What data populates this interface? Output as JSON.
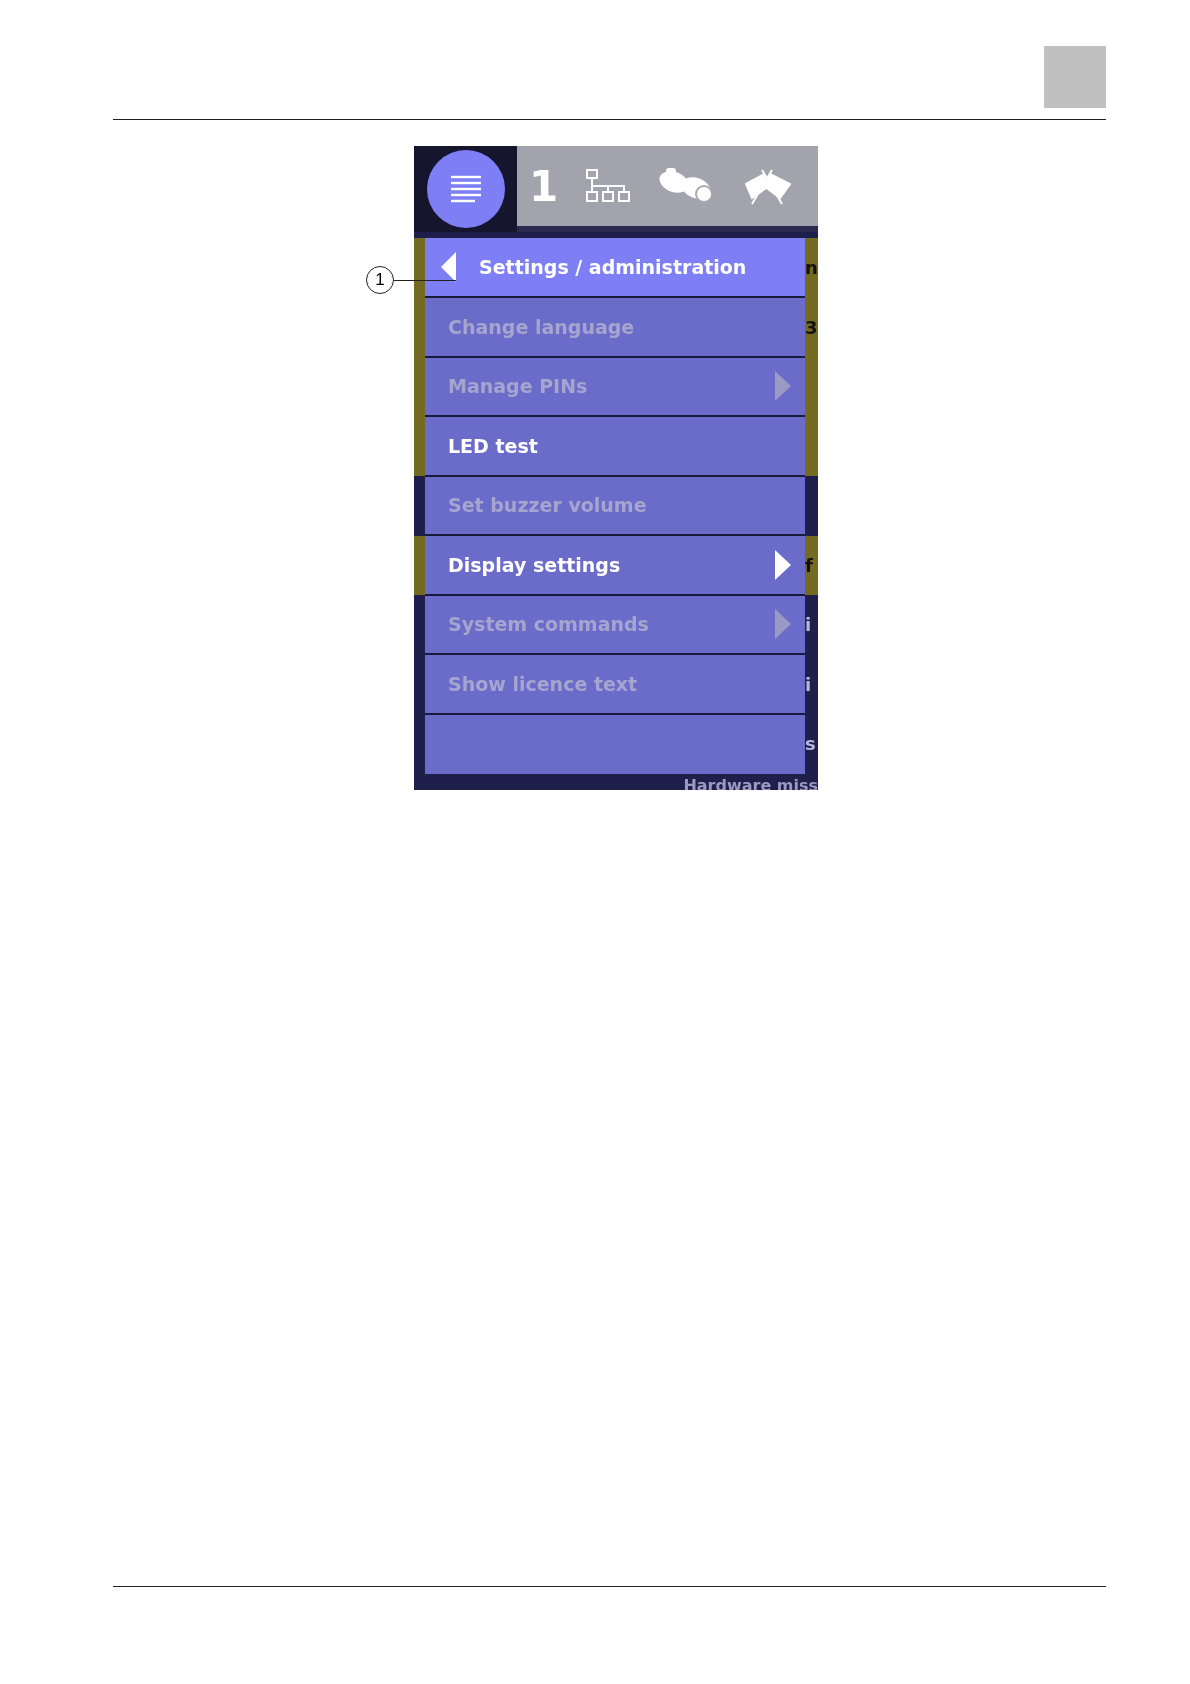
{
  "toolbar": {
    "menu_selected": true,
    "count": "1"
  },
  "menu": {
    "title": "Settings / administration",
    "items": [
      {
        "label": "Change language",
        "disabled": true,
        "submenu": false
      },
      {
        "label": "Manage PINs",
        "disabled": true,
        "submenu": true
      },
      {
        "label": "LED test",
        "disabled": false,
        "submenu": false
      },
      {
        "label": "Set buzzer volume",
        "disabled": true,
        "submenu": false
      },
      {
        "label": "Display settings",
        "disabled": false,
        "submenu": true
      },
      {
        "label": "System commands",
        "disabled": true,
        "submenu": true
      },
      {
        "label": "Show licence text",
        "disabled": true,
        "submenu": false
      }
    ]
  },
  "background_rows": [
    {
      "kind": "alarm",
      "fragment": "n"
    },
    {
      "kind": "alarm",
      "fragment": "3"
    },
    {
      "kind": "alarm"
    },
    {
      "kind": "alarm"
    },
    {
      "kind": "normal"
    },
    {
      "kind": "alarm",
      "fragment": "f"
    },
    {
      "kind": "normal",
      "fragment": "i"
    },
    {
      "kind": "normal",
      "fragment": "i"
    },
    {
      "kind": "normal",
      "fragment": "s"
    }
  ],
  "background_footer": "Hardware miss",
  "callout": "1"
}
